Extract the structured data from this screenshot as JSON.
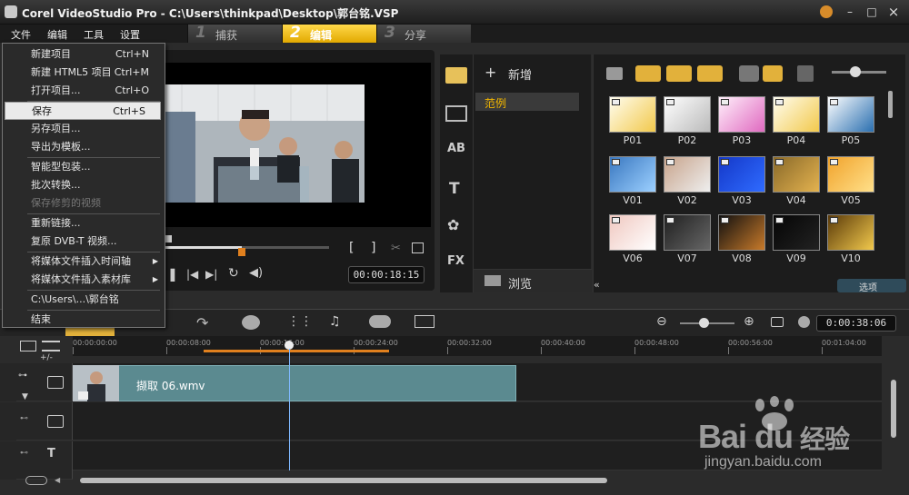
{
  "window": {
    "title": "Corel VideoStudio Pro - C:\\Users\\thinkpad\\Desktop\\郭台铭.VSP",
    "minimize": "–",
    "maximize": "□",
    "close": "×"
  },
  "menubar": {
    "items": [
      "文件",
      "编辑",
      "工具",
      "设置"
    ]
  },
  "steps": [
    {
      "num": "1",
      "label": "捕获",
      "active": false
    },
    {
      "num": "2",
      "label": "编辑",
      "active": true
    },
    {
      "num": "3",
      "label": "分享",
      "active": false
    }
  ],
  "file_menu": {
    "items": [
      {
        "label": "新建项目",
        "shortcut": "Ctrl+N"
      },
      {
        "label": "新建 HTML5 项目",
        "shortcut": "Ctrl+M"
      },
      {
        "label": "打开项目...",
        "shortcut": "Ctrl+O"
      },
      {
        "label": "保存",
        "shortcut": "Ctrl+S",
        "highlighted": true
      },
      {
        "label": "另存项目..."
      },
      {
        "label": "导出为模板..."
      },
      {
        "label": "智能型包装..."
      },
      {
        "label": "批次转换..."
      },
      {
        "label": "保存修剪的视频",
        "disabled": true
      },
      {
        "label": "重新链接..."
      },
      {
        "label": "复原 DVB-T 视频..."
      },
      {
        "label": "将媒体文件插入时间轴",
        "submenu": true
      },
      {
        "label": "将媒体文件插入素材库",
        "submenu": true
      },
      {
        "label": "C:\\Users\\...\\郭台铭"
      },
      {
        "label": "结束"
      }
    ]
  },
  "library": {
    "add_label": "新增",
    "folder": "范例",
    "browse_label": "浏览",
    "options_label": "选项",
    "thumbnails": [
      "P01",
      "P02",
      "P03",
      "P04",
      "P05",
      "V01",
      "V02",
      "V03",
      "V04",
      "V05",
      "V06",
      "V07",
      "V08",
      "V09",
      "V10"
    ]
  },
  "preview": {
    "mark_in": "[",
    "mark_out": "]",
    "clip_timecode_prefix": "00:00:",
    "clip_timecode": "18:15",
    "progress": 0.47
  },
  "timeline": {
    "total_timecode": "0:00:38:06",
    "add_remove_label": "+/-",
    "ticks": [
      "00:00:00:00",
      "00:00:08:00",
      "00:00:16:00",
      "00:00:24:00",
      "00:00:32:00",
      "00:00:40:00",
      "00:00:48:00",
      "00:00:56:00",
      "00:01:04:00"
    ],
    "clip_name": "撷取 06.wmv"
  },
  "watermark": {
    "brand": "Bai  du",
    "product": "经验",
    "url": "jingyan.baidu.com"
  },
  "colors": {
    "accent": "#f2b600",
    "clip": "#5b8a90",
    "playhead": "#7fb8ff",
    "trim_bar": "#e0801e"
  }
}
